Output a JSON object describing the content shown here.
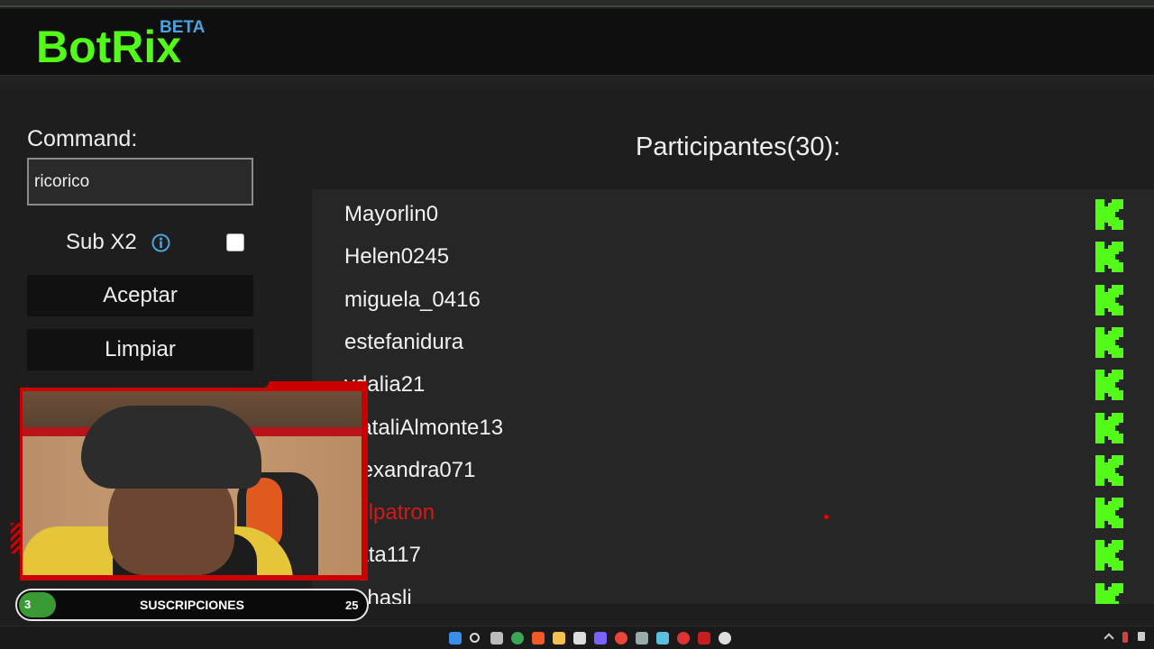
{
  "header": {
    "logo_text": "BotRix",
    "badge_text": "BETA",
    "logo_color": "#53fc18",
    "badge_color": "#4aa3e0"
  },
  "form": {
    "command_label": "Command:",
    "command_value": "ricorico",
    "sub_label": "Sub X2",
    "sub_checked": false,
    "accept_label": "Aceptar",
    "clear_label": "Limpiar"
  },
  "participants": {
    "title": "Participantes(30):",
    "items": [
      {
        "name": "Mayorlin0",
        "icon": "kick-icon"
      },
      {
        "name": "Helen0245",
        "icon": "kick-icon"
      },
      {
        "name": "miguela_0416",
        "icon": "kick-icon"
      },
      {
        "name": "estefanidura",
        "icon": "kick-icon"
      },
      {
        "name": "ydalia21",
        "icon": "kick-icon"
      },
      {
        "name": "NataliAlmonte13",
        "icon": "kick-icon"
      },
      {
        "name": "alexandra071",
        "icon": "kick-icon"
      },
      {
        "name": "_elpatron",
        "icon": "kick-icon",
        "highlight_color": "#d11a1a"
      },
      {
        "name": "nata117",
        "icon": "kick-icon"
      },
      {
        "name": "kahasli",
        "icon": "kick-icon"
      }
    ]
  },
  "subs_goal": {
    "current": "3",
    "label": "SUSCRIPCIONES",
    "goal": "25",
    "progress_fraction": 0.12,
    "fill_color": "#3a9a36"
  },
  "colors": {
    "accent_green": "#53fc18",
    "webcam_frame": "#cc0000"
  }
}
